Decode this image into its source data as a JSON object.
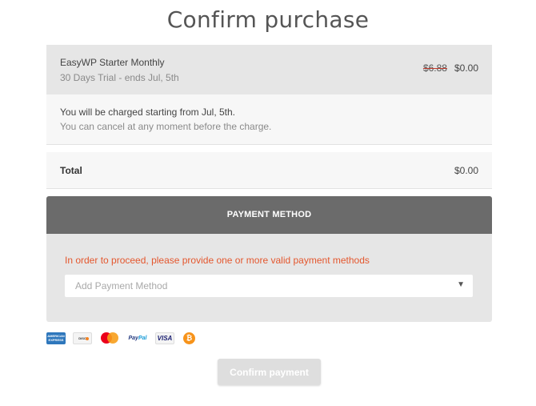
{
  "page": {
    "title": "Confirm purchase"
  },
  "order": {
    "product_name": "EasyWP Starter Monthly",
    "trial_text": "30 Days Trial - ends Jul, 5th",
    "original_price": "$6.88",
    "price": "$0.00"
  },
  "notice": {
    "line1": "You will be charged starting from Jul, 5th.",
    "line2": "You can cancel at any moment before the charge."
  },
  "total": {
    "label": "Total",
    "amount": "$0.00"
  },
  "payment": {
    "header": "PAYMENT METHOD",
    "error": "In order to proceed, please provide one or more valid payment methods",
    "select_placeholder": "Add Payment Method"
  },
  "accepted_methods": [
    {
      "name": "american-express",
      "icon": "amex-card-icon"
    },
    {
      "name": "discover",
      "icon": "discover-card-icon"
    },
    {
      "name": "mastercard",
      "icon": "mastercard-icon"
    },
    {
      "name": "paypal",
      "icon": "paypal-icon"
    },
    {
      "name": "visa",
      "icon": "visa-card-icon"
    },
    {
      "name": "bitcoin",
      "icon": "bitcoin-icon"
    }
  ],
  "actions": {
    "confirm_label": "Confirm payment"
  },
  "colors": {
    "error": "#e4572e",
    "header_bg": "#6b6b6b",
    "disabled_button": "#dedede",
    "strike": "#c0392b"
  }
}
